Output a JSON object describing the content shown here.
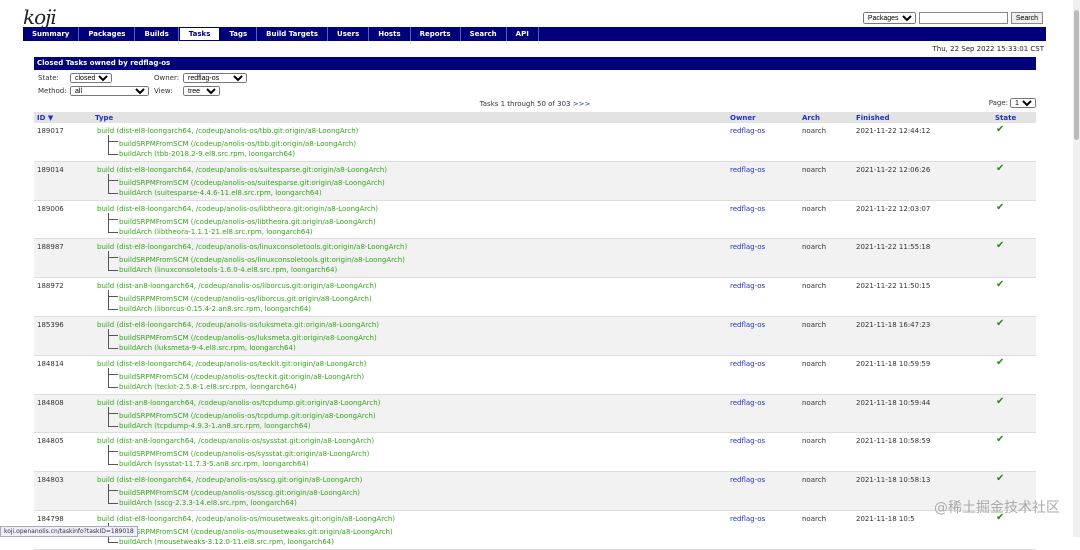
{
  "logo": "koji",
  "search": {
    "type_selected": "Packages",
    "value": "",
    "button": "Search"
  },
  "nav": [
    "Summary",
    "Packages",
    "Builds",
    "Tasks",
    "Tags",
    "Build Targets",
    "Users",
    "Hosts",
    "Reports",
    "Search",
    "API"
  ],
  "active_tab": "Tasks",
  "datetime": "Thu, 22 Sep 2022 15:33:01 CST",
  "panel_title": "Closed Tasks owned by redflag-os",
  "filters": {
    "state_label": "State:",
    "state_value": "closed",
    "owner_label": "Owner:",
    "owner_value": "redflag-os",
    "method_label": "Method:",
    "method_value": "all",
    "view_label": "View:",
    "view_value": "tree"
  },
  "pager": {
    "text": "Tasks 1 through 50 of 303",
    "more": ">>>",
    "page_label": "Page:",
    "page_value": "1"
  },
  "columns": {
    "id": "ID ▼",
    "type": "Type",
    "owner": "Owner",
    "arch": "Arch",
    "finished": "Finished",
    "state": "State"
  },
  "rows": [
    {
      "id": "189017",
      "type": "build (dist-el8-loongarch64, /codeup/anolis-os/tbb.git:origin/a8-LoongArch)",
      "srpm": "buildSRPMFromSCM (/codeup/anolis-os/tbb.git:origin/a8-LoongArch)",
      "arch_task": "buildArch (tbb-2018.2-9.el8.src.rpm, loongarch64)",
      "owner": "redflag-os",
      "arch": "noarch",
      "finished": "2021-11-22 12:44:12",
      "state": "✔"
    },
    {
      "id": "189014",
      "type": "build (dist-el8-loongarch64, /codeup/anolis-os/suitesparse.git:origin/a8-LoongArch)",
      "srpm": "buildSRPMFromSCM (/codeup/anolis-os/suitesparse.git:origin/a8-LoongArch)",
      "arch_task": "buildArch (suitesparse-4.4.6-11.el8.src.rpm, loongarch64)",
      "owner": "redflag-os",
      "arch": "noarch",
      "finished": "2021-11-22 12:06:26",
      "state": "✔"
    },
    {
      "id": "189006",
      "type": "build (dist-el8-loongarch64, /codeup/anolis-os/libtheora.git:origin/a8-LoongArch)",
      "srpm": "buildSRPMFromSCM (/codeup/anolis-os/libtheora.git:origin/a8-LoongArch)",
      "arch_task": "buildArch (libtheora-1.1.1-21.el8.src.rpm, loongarch64)",
      "owner": "redflag-os",
      "arch": "noarch",
      "finished": "2021-11-22 12:03:07",
      "state": "✔"
    },
    {
      "id": "188987",
      "type": "build (dist-el8-loongarch64, /codeup/anolis-os/linuxconsoletools.git:origin/a8-LoongArch)",
      "srpm": "buildSRPMFromSCM (/codeup/anolis-os/linuxconsoletools.git:origin/a8-LoongArch)",
      "arch_task": "buildArch (linuxconsoletools-1.6.0-4.el8.src.rpm, loongarch64)",
      "owner": "redflag-os",
      "arch": "noarch",
      "finished": "2021-11-22 11:55:18",
      "state": "✔"
    },
    {
      "id": "188972",
      "type": "build (dist-an8-loongarch64, /codeup/anolis-os/liborcus.git:origin/a8-LoongArch)",
      "srpm": "buildSRPMFromSCM (/codeup/anolis-os/liborcus.git:origin/a8-LoongArch)",
      "arch_task": "buildArch (liborcus-0.15.4-2.an8.src.rpm, loongarch64)",
      "owner": "redflag-os",
      "arch": "noarch",
      "finished": "2021-11-22 11:50:15",
      "state": "✔"
    },
    {
      "id": "185396",
      "type": "build (dist-el8-loongarch64, /codeup/anolis-os/luksmeta.git:origin/a8-LoongArch)",
      "srpm": "buildSRPMFromSCM (/codeup/anolis-os/luksmeta.git:origin/a8-LoongArch)",
      "arch_task": "buildArch (luksmeta-9-4.el8.src.rpm, loongarch64)",
      "owner": "redflag-os",
      "arch": "noarch",
      "finished": "2021-11-18 16:47:23",
      "state": "✔"
    },
    {
      "id": "184814",
      "type": "build (dist-el8-loongarch64, /codeup/anolis-os/teckit.git:origin/a8-LoongArch)",
      "srpm": "buildSRPMFromSCM (/codeup/anolis-os/teckit.git:origin/a8-LoongArch)",
      "arch_task": "buildArch (teckit-2.5.8-1.el8.src.rpm, loongarch64)",
      "owner": "redflag-os",
      "arch": "noarch",
      "finished": "2021-11-18 10:59:59",
      "state": "✔"
    },
    {
      "id": "184808",
      "type": "build (dist-an8-loongarch64, /codeup/anolis-os/tcpdump.git:origin/a8-LoongArch)",
      "srpm": "buildSRPMFromSCM (/codeup/anolis-os/tcpdump.git:origin/a8-LoongArch)",
      "arch_task": "buildArch (tcpdump-4.9.3-1.an8.src.rpm, loongarch64)",
      "owner": "redflag-os",
      "arch": "noarch",
      "finished": "2021-11-18 10:59:44",
      "state": "✔"
    },
    {
      "id": "184805",
      "type": "build (dist-an8-loongarch64, /codeup/anolis-os/sysstat.git:origin/a8-LoongArch)",
      "srpm": "buildSRPMFromSCM (/codeup/anolis-os/sysstat.git:origin/a8-LoongArch)",
      "arch_task": "buildArch (sysstat-11.7.3-5.an8.src.rpm, loongarch64)",
      "owner": "redflag-os",
      "arch": "noarch",
      "finished": "2021-11-18 10:58:59",
      "state": "✔"
    },
    {
      "id": "184803",
      "type": "build (dist-el8-loongarch64, /codeup/anolis-os/sscg.git:origin/a8-LoongArch)",
      "srpm": "buildSRPMFromSCM (/codeup/anolis-os/sscg.git:origin/a8-LoongArch)",
      "arch_task": "buildArch (sscg-2.3.3-14.el8.src.rpm, loongarch64)",
      "owner": "redflag-os",
      "arch": "noarch",
      "finished": "2021-11-18 10:58:13",
      "state": "✔"
    },
    {
      "id": "184798",
      "type": "build (dist-el8-loongarch64, /codeup/anolis-os/mousetweaks.git:origin/a8-LoongArch)",
      "srpm": "buildSRPMFromSCM (/codeup/anolis-os/mousetweaks.git:origin/a8-LoongArch)",
      "arch_task": "buildArch (mousetweaks-3.12.0-11.el8.src.rpm, loongarch64)",
      "owner": "redflag-os",
      "arch": "noarch",
      "finished": "2021-11-18 10:5",
      "state": "✔"
    }
  ],
  "status_url": "koji.openanolis.cn/taskinfo?taskID=189018",
  "watermark": "@稀土掘金技术社区"
}
